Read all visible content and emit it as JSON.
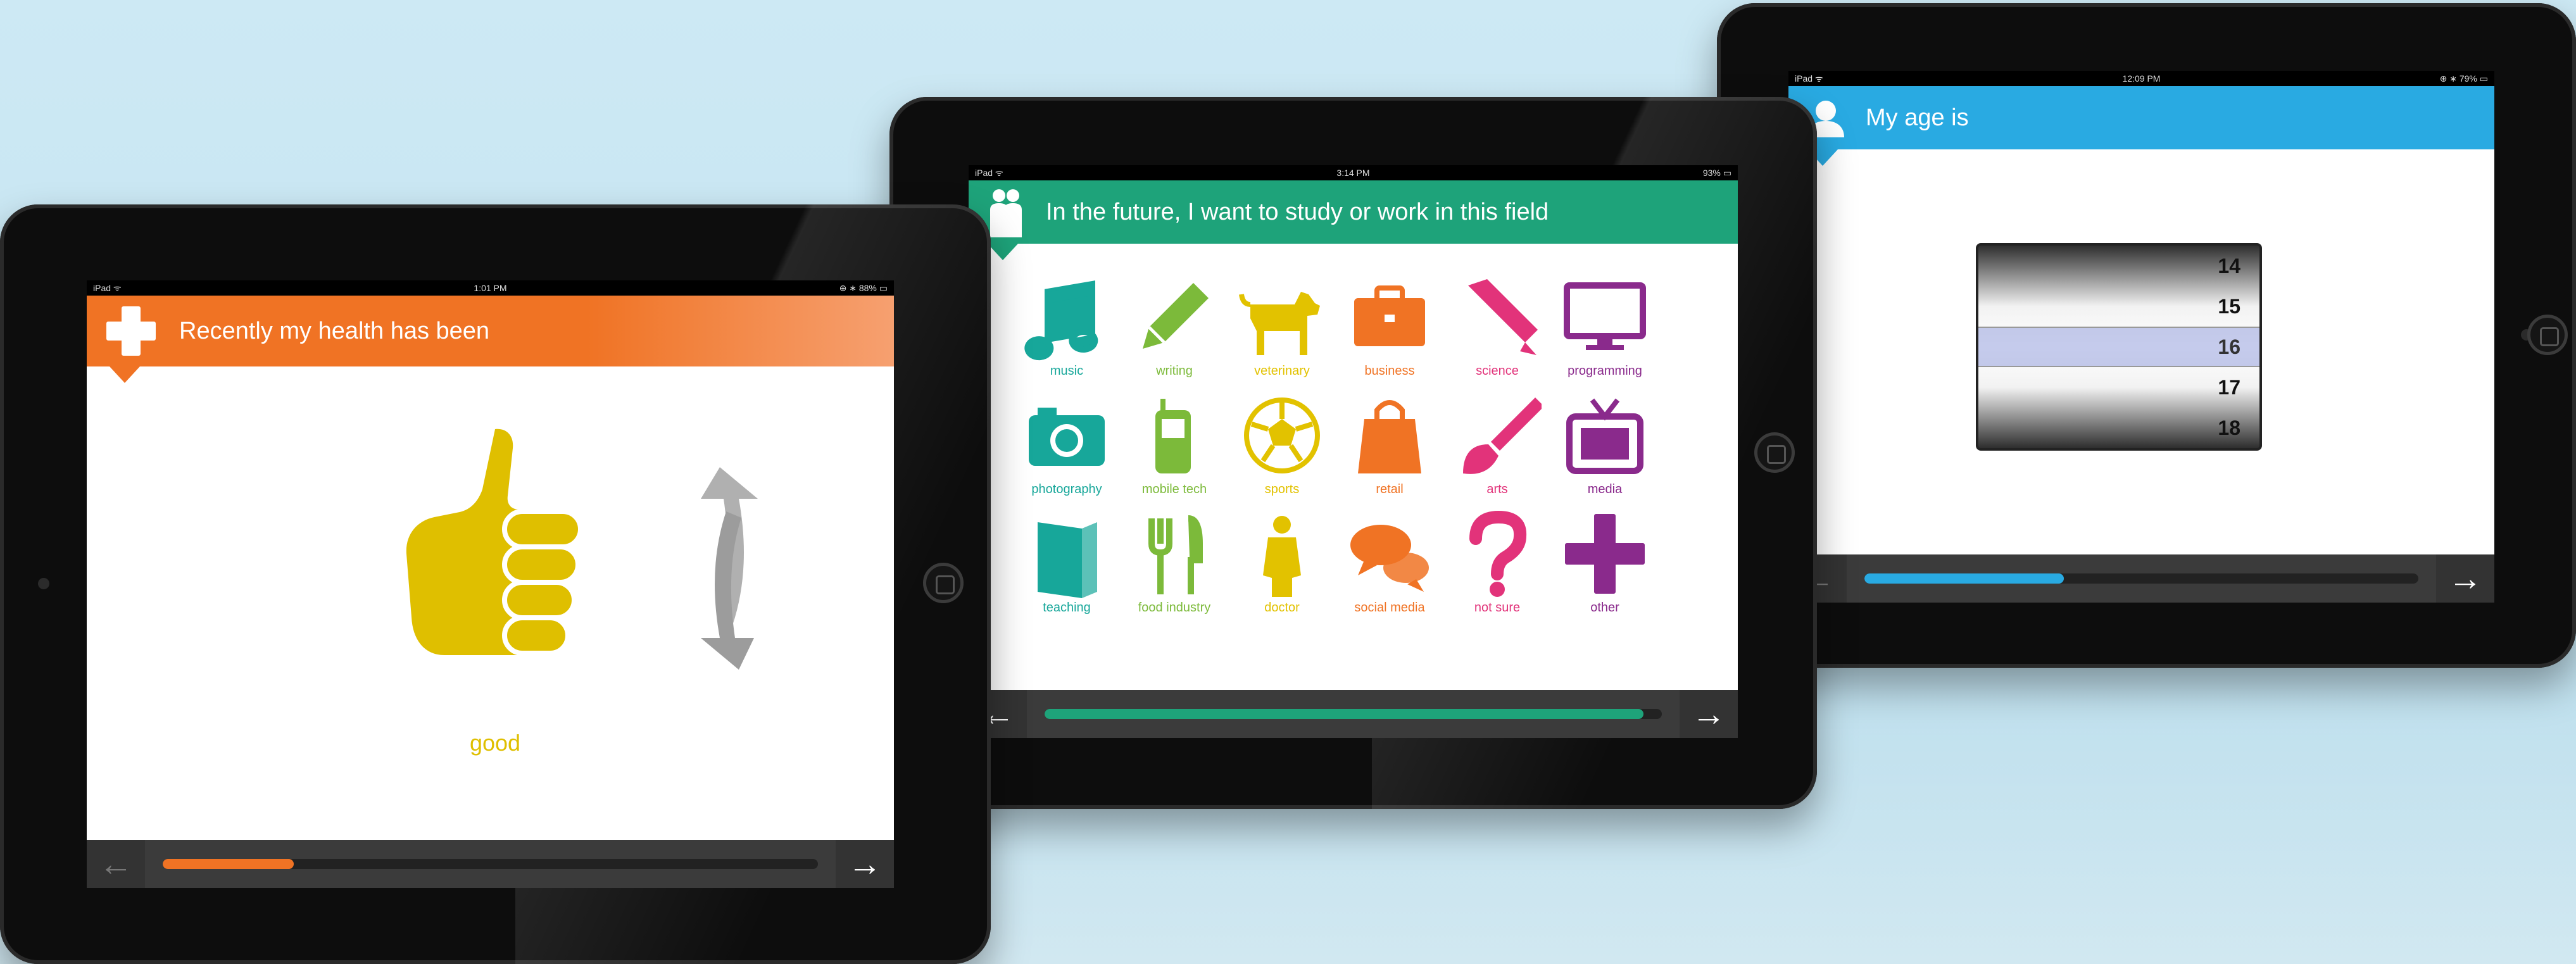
{
  "colors": {
    "health": "#f07324",
    "field": "#1ea37a",
    "age": "#29aae2",
    "thumb": "#dfbf00",
    "arrows": "#b0b0b0",
    "teal": "#17a79a",
    "green": "#7cba3a",
    "yellow": "#e2c200",
    "orange": "#f07324",
    "pink": "#e2337a",
    "purple": "#8a2a8c"
  },
  "left_ipad": {
    "status": {
      "carrier": "iPad ᯤ",
      "time": "1:01 PM",
      "battery": "⊕ ∗ 88% ▭"
    },
    "header_icon": "plus-cross-icon",
    "title": "Recently my health has been",
    "answer_icon": "thumbs-up-icon",
    "swap_icon": "swap-arrows-icon",
    "answer": "good",
    "progress": 0.2
  },
  "middle_ipad": {
    "status": {
      "carrier": "iPad ᯤ",
      "time": "3:14 PM",
      "battery": "93% ▭"
    },
    "header_icon": "people-icon",
    "title": "In the future, I want to study or work in this field",
    "progress": 0.97,
    "options": [
      {
        "label": "music",
        "icon": "music-icon",
        "color": "teal"
      },
      {
        "label": "writing",
        "icon": "pencil-icon",
        "color": "green"
      },
      {
        "label": "veterinary",
        "icon": "dog-icon",
        "color": "yellow"
      },
      {
        "label": "business",
        "icon": "briefcase-icon",
        "color": "orange"
      },
      {
        "label": "science",
        "icon": "pen-icon",
        "color": "pink"
      },
      {
        "label": "programming",
        "icon": "monitor-icon",
        "color": "purple"
      },
      {
        "label": "photography",
        "icon": "camera-icon",
        "color": "teal"
      },
      {
        "label": "mobile tech",
        "icon": "phone-icon",
        "color": "green"
      },
      {
        "label": "sports",
        "icon": "soccer-ball-icon",
        "color": "yellow"
      },
      {
        "label": "retail",
        "icon": "shopping-bag-icon",
        "color": "orange"
      },
      {
        "label": "arts",
        "icon": "brush-icon",
        "color": "pink"
      },
      {
        "label": "media",
        "icon": "tv-icon",
        "color": "purple"
      },
      {
        "label": "teaching",
        "icon": "book-icon",
        "color": "teal"
      },
      {
        "label": "food industry",
        "icon": "fork-knife-icon",
        "color": "green"
      },
      {
        "label": "doctor",
        "icon": "doctor-icon",
        "color": "yellow"
      },
      {
        "label": "social media",
        "icon": "chat-bubbles-icon",
        "color": "orange"
      },
      {
        "label": "not sure",
        "icon": "question-icon",
        "color": "pink"
      },
      {
        "label": "other",
        "icon": "plus-icon",
        "color": "purple"
      }
    ]
  },
  "right_ipad": {
    "status": {
      "carrier": "iPad ᯤ",
      "time": "12:09 PM",
      "battery": "⊕ ∗ 79% ▭"
    },
    "header_icon": "person-icon",
    "title": "My age is",
    "ages": [
      "14",
      "15",
      "16",
      "17",
      "18"
    ],
    "selected_age": "16",
    "progress": 0.36
  }
}
